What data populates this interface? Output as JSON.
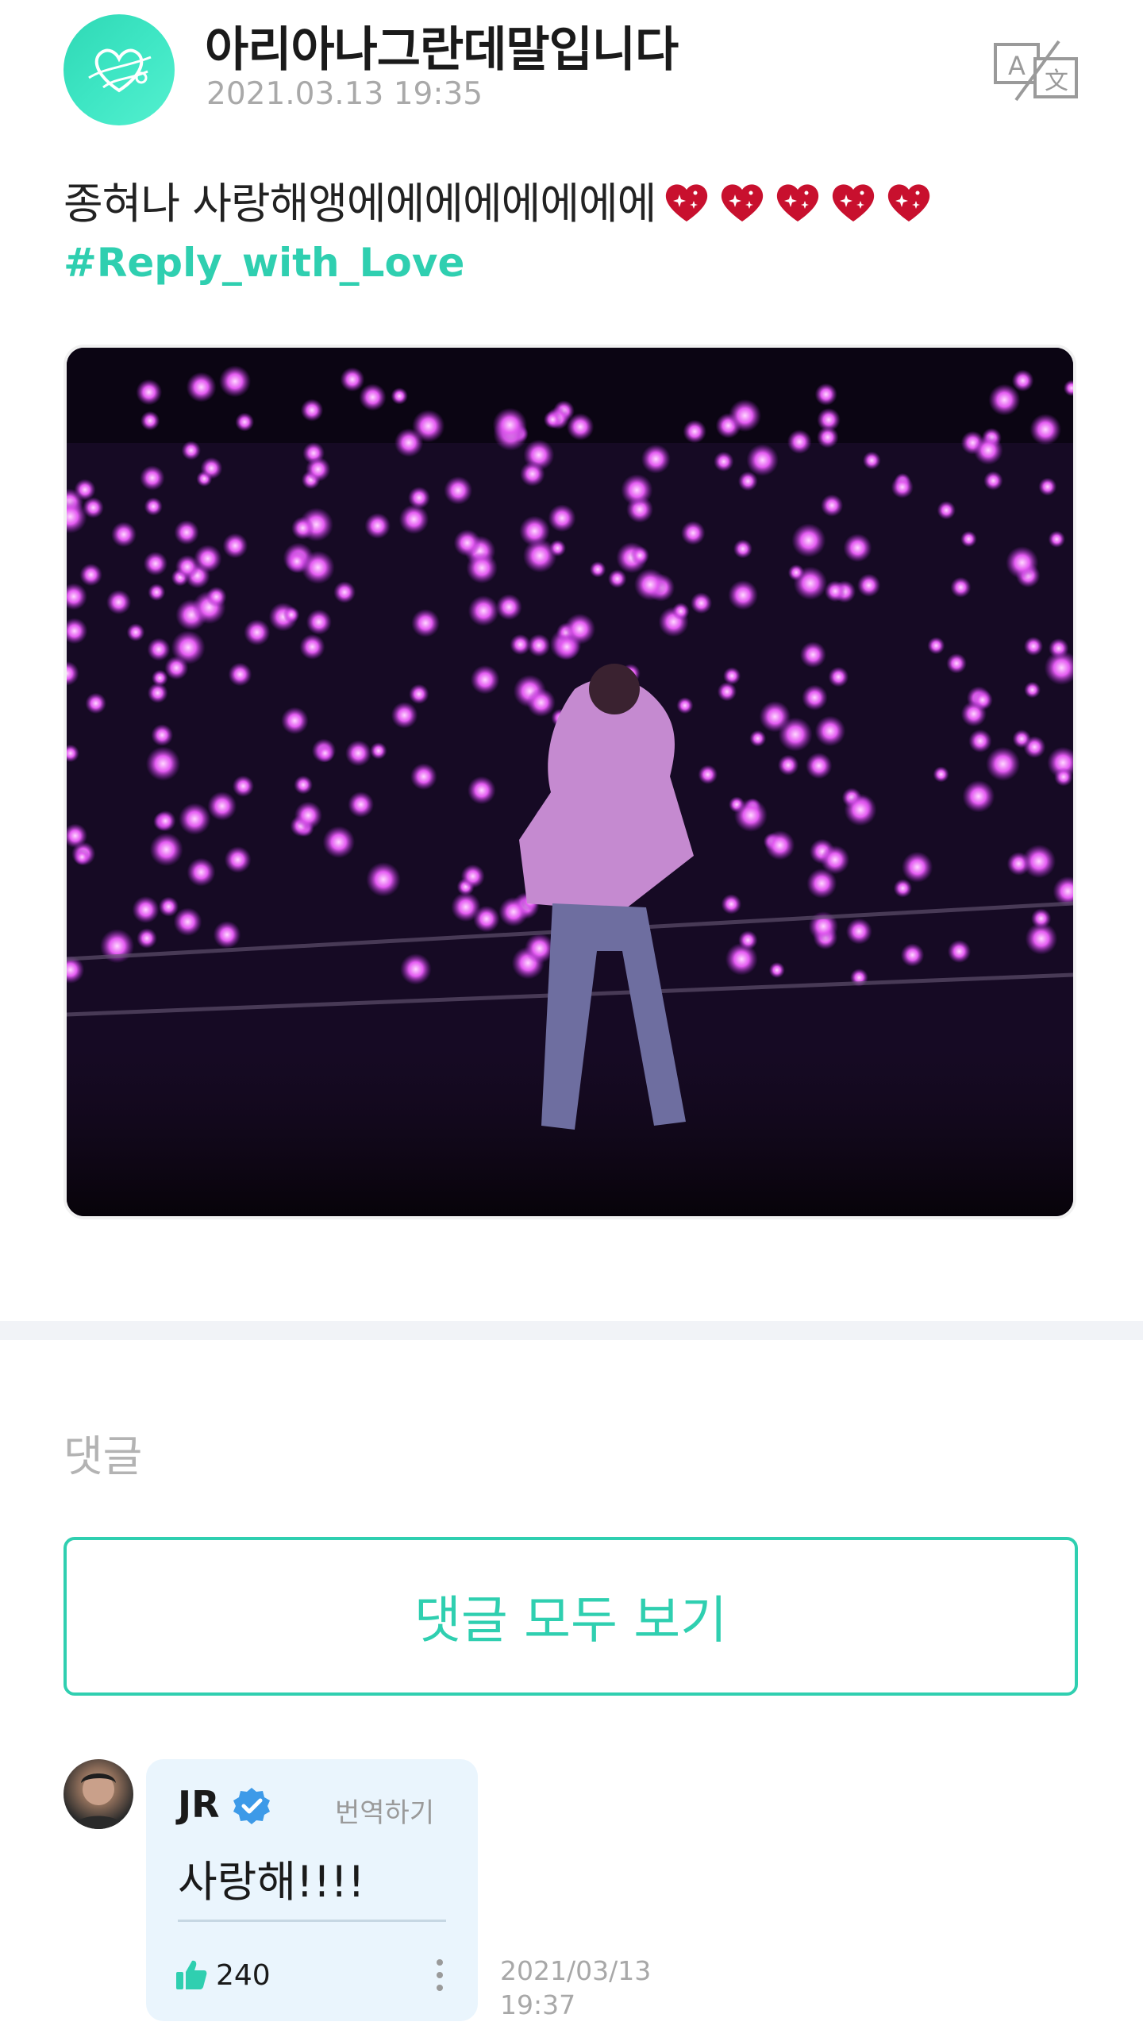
{
  "post": {
    "username": "아리아나그란데말입니다",
    "timestamp": "2021.03.13 19:35",
    "text": "종혀나 사랑해앵에에에에에에에에",
    "heart_count": 5,
    "hashtag": "#Reply_with_Love",
    "image_alt": "concert crowd with pink heart lightsticks",
    "translate_icon": "translate-icon"
  },
  "comments": {
    "heading": "댓글",
    "view_all_label": "댓글 모두 보기",
    "items": [
      {
        "author": "JR",
        "verified": true,
        "translate_label": "번역하기",
        "text": "사랑해!!!!",
        "likes": "240",
        "date": "2021/03/13",
        "time": "19:37"
      }
    ]
  },
  "colors": {
    "accent": "#2fcfb0",
    "bubble": "#eaf5fd",
    "verified": "#3d9ae8",
    "heart": "#c8102e"
  }
}
